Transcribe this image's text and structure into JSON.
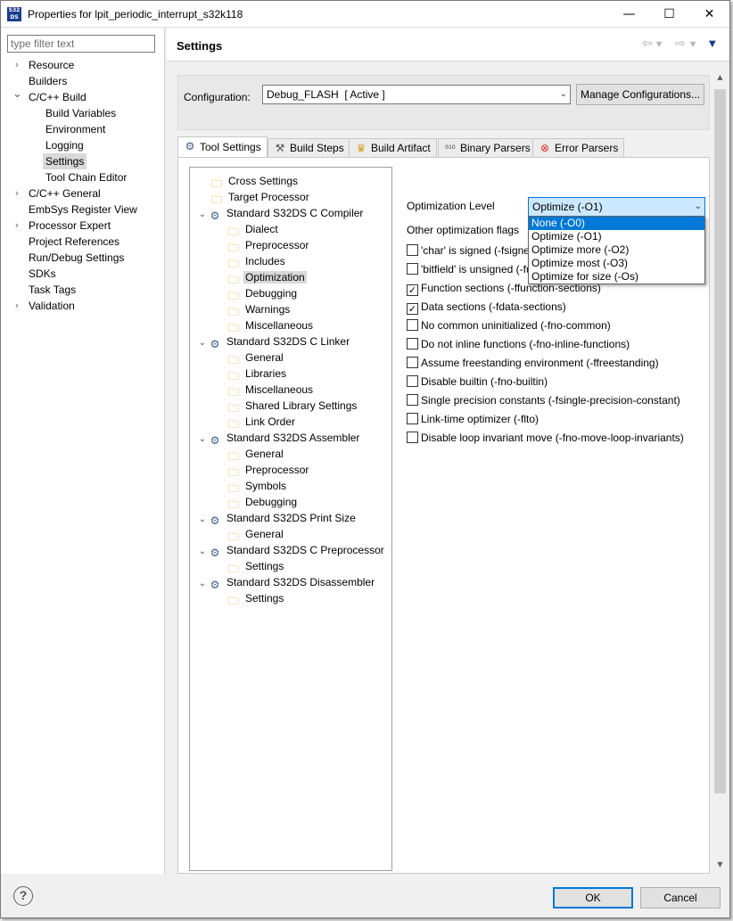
{
  "window": {
    "icon_text": "S32DS",
    "title": "Properties for lpit_periodic_interrupt_s32k118",
    "minimize": "—",
    "maximize": "☐",
    "close": "✕"
  },
  "filter": {
    "placeholder": "type filter text",
    "value": ""
  },
  "nav": [
    {
      "label": "Resource",
      "expandable": true
    },
    {
      "label": "Builders",
      "expandable": false
    },
    {
      "label": "C/C++ Build",
      "expandable": true,
      "expanded": true
    },
    {
      "label": "Build Variables",
      "child": true
    },
    {
      "label": "Environment",
      "child": true
    },
    {
      "label": "Logging",
      "child": true
    },
    {
      "label": "Settings",
      "child": true,
      "selected": true
    },
    {
      "label": "Tool Chain Editor",
      "child": true
    },
    {
      "label": "C/C++ General",
      "expandable": true
    },
    {
      "label": "EmbSys Register View",
      "expandable": false
    },
    {
      "label": "Processor Expert",
      "expandable": true
    },
    {
      "label": "Project References",
      "expandable": false
    },
    {
      "label": "Run/Debug Settings",
      "expandable": false
    },
    {
      "label": "SDKs",
      "expandable": false
    },
    {
      "label": "Task Tags",
      "expandable": false
    },
    {
      "label": "Validation",
      "expandable": true
    }
  ],
  "header": {
    "title": "Settings"
  },
  "configuration": {
    "label": "Configuration:",
    "value": "Debug_FLASH  [ Active ]",
    "manage_button": "Manage Configurations..."
  },
  "tabs": [
    {
      "label": "Tool Settings",
      "icon": "gear-icon",
      "active": true
    },
    {
      "label": "Build Steps",
      "icon": "hammer-icon"
    },
    {
      "label": "Build Artifact",
      "icon": "trophy-icon"
    },
    {
      "label": "Binary Parsers",
      "icon": "binary-icon"
    },
    {
      "label": "Error Parsers",
      "icon": "error-icon"
    }
  ],
  "tool_tree": [
    {
      "label": "Cross Settings",
      "level": 1,
      "type": "folder"
    },
    {
      "label": "Target Processor",
      "level": 1,
      "type": "folder"
    },
    {
      "label": "Standard S32DS C Compiler",
      "level": 0,
      "type": "gear"
    },
    {
      "label": "Dialect",
      "level": 2,
      "type": "folder"
    },
    {
      "label": "Preprocessor",
      "level": 2,
      "type": "folder"
    },
    {
      "label": "Includes",
      "level": 2,
      "type": "folder"
    },
    {
      "label": "Optimization",
      "level": 2,
      "type": "folder",
      "selected": true
    },
    {
      "label": "Debugging",
      "level": 2,
      "type": "folder"
    },
    {
      "label": "Warnings",
      "level": 2,
      "type": "folder"
    },
    {
      "label": "Miscellaneous",
      "level": 2,
      "type": "folder"
    },
    {
      "label": "Standard S32DS C Linker",
      "level": 0,
      "type": "gear"
    },
    {
      "label": "General",
      "level": 2,
      "type": "folder"
    },
    {
      "label": "Libraries",
      "level": 2,
      "type": "folder"
    },
    {
      "label": "Miscellaneous",
      "level": 2,
      "type": "folder"
    },
    {
      "label": "Shared Library Settings",
      "level": 2,
      "type": "folder"
    },
    {
      "label": "Link Order",
      "level": 2,
      "type": "folder"
    },
    {
      "label": "Standard S32DS Assembler",
      "level": 0,
      "type": "gear"
    },
    {
      "label": "General",
      "level": 2,
      "type": "folder"
    },
    {
      "label": "Preprocessor",
      "level": 2,
      "type": "folder"
    },
    {
      "label": "Symbols",
      "level": 2,
      "type": "folder"
    },
    {
      "label": "Debugging",
      "level": 2,
      "type": "folder"
    },
    {
      "label": "Standard S32DS Print Size",
      "level": 0,
      "type": "gear"
    },
    {
      "label": "General",
      "level": 2,
      "type": "folder"
    },
    {
      "label": "Standard S32DS C Preprocessor",
      "level": 0,
      "type": "gear"
    },
    {
      "label": "Settings",
      "level": 2,
      "type": "folder"
    },
    {
      "label": "Standard S32DS Disassembler",
      "level": 0,
      "type": "gear"
    },
    {
      "label": "Settings",
      "level": 2,
      "type": "folder"
    }
  ],
  "optimization": {
    "level_label": "Optimization Level",
    "level_value": "Optimize (-O1)",
    "other_flags_label": "Other optimization flags",
    "dropdown_options": [
      {
        "label": "None (-O0)",
        "highlighted": true
      },
      {
        "label": "Optimize (-O1)"
      },
      {
        "label": "Optimize more (-O2)"
      },
      {
        "label": "Optimize most (-O3)"
      },
      {
        "label": "Optimize for size (-Os)"
      }
    ],
    "flags": [
      {
        "label": "'char' is signed (-fsigned-char)",
        "checked": false
      },
      {
        "label": "'bitfield' is unsigned (-funsigned-bitfields)",
        "checked": false
      },
      {
        "label": "Function sections (-ffunction-sections)",
        "checked": true
      },
      {
        "label": "Data sections (-fdata-sections)",
        "checked": true
      },
      {
        "label": "No common uninitialized (-fno-common)",
        "checked": false
      },
      {
        "label": "Do not inline functions (-fno-inline-functions)",
        "checked": false
      },
      {
        "label": "Assume freestanding environment (-ffreestanding)",
        "checked": false
      },
      {
        "label": "Disable builtin (-fno-builtin)",
        "checked": false
      },
      {
        "label": "Single precision constants (-fsingle-precision-constant)",
        "checked": false
      },
      {
        "label": "Link-time optimizer (-flto)",
        "checked": false
      },
      {
        "label": "Disable loop invariant move (-fno-move-loop-invariants)",
        "checked": false
      }
    ]
  },
  "buttons": {
    "help": "?",
    "ok": "OK",
    "cancel": "Cancel"
  },
  "colors": {
    "selection_blue": "#0078d7",
    "selected_gray": "#d9d9d9"
  }
}
